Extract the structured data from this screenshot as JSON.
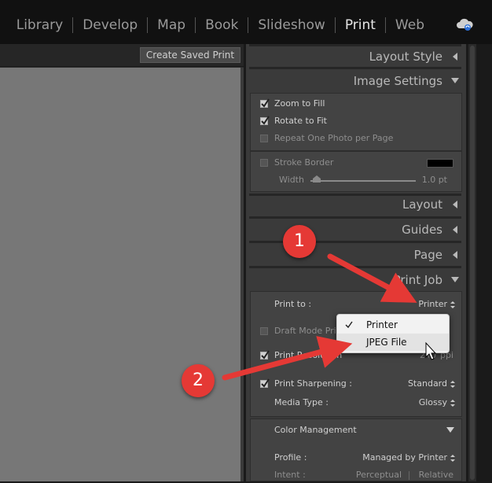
{
  "modules": [
    "Library",
    "Develop",
    "Map",
    "Book",
    "Slideshow",
    "Print",
    "Web"
  ],
  "active_module": "Print",
  "toolbar": {
    "create_saved_print": "Create Saved Print"
  },
  "panels": {
    "layout_style": "Layout Style",
    "image_settings": "Image Settings",
    "layout": "Layout",
    "guides": "Guides",
    "page": "Page",
    "print_job": "Print Job"
  },
  "image_settings": {
    "zoom_to_fill": "Zoom to Fill",
    "rotate_to_fit": "Rotate to Fit",
    "repeat_one_photo": "Repeat One Photo per Page",
    "stroke_border": "Stroke Border",
    "width_label": "Width",
    "width_value": "1.0 pt"
  },
  "print_job": {
    "print_to_label": "Print to :",
    "print_to_value": "Printer",
    "draft_mode": "Draft Mode Print",
    "print_resolution": "Print Resolution",
    "resolution_value": "240",
    "resolution_unit": "ppi",
    "print_sharpening": "Print Sharpening :",
    "sharpening_value": "Standard",
    "media_type": "Media Type :",
    "media_value": "Glossy"
  },
  "color_management": {
    "title": "Color Management",
    "profile_label": "Profile :",
    "profile_value": "Managed by Printer",
    "intent_label": "Intent :",
    "intent_perceptual": "Perceptual",
    "intent_relative": "Relative"
  },
  "dropdown": {
    "options": [
      "Printer",
      "JPEG File"
    ],
    "selected": "Printer",
    "hover": "JPEG File"
  },
  "annotations": {
    "badge1": "1",
    "badge2": "2"
  },
  "colors": {
    "accent": "#e53935",
    "panel_bg": "#3a3a3a"
  }
}
